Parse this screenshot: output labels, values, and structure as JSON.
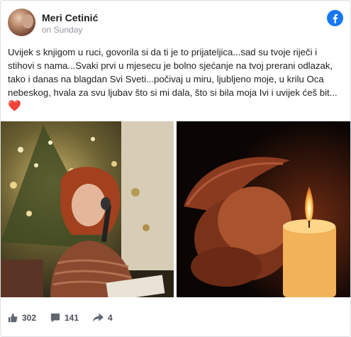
{
  "post": {
    "author": "Meri Cetinić",
    "timestamp": "on Sunday",
    "text": "Uvijek s knjigom u ruci, govorila si da ti je to prijateljica...sad su tvoje riječi i stihovi s nama...Svaki prvi u mjesecu je bolno sjećanje na tvoj prerani odlazak, tako i danas na blagdan Svi Sveti...počivaj u miru, ljubljeno moje, u krilu Oca nebeskog, hvala za svu ljubav što si mi dala, što si bila moja Ivi i uvijek ćeš bit...",
    "emoji": "❤️"
  },
  "stats": {
    "likes": "302",
    "comments": "141",
    "shares": "4"
  },
  "icons": {
    "brand": "facebook-icon",
    "like": "thumbs-up-icon",
    "comment": "comment-icon",
    "share": "share-arrow-icon"
  },
  "colors": {
    "brand": "#1877f2",
    "heart": "#e0245e",
    "muted": "#90949c"
  }
}
